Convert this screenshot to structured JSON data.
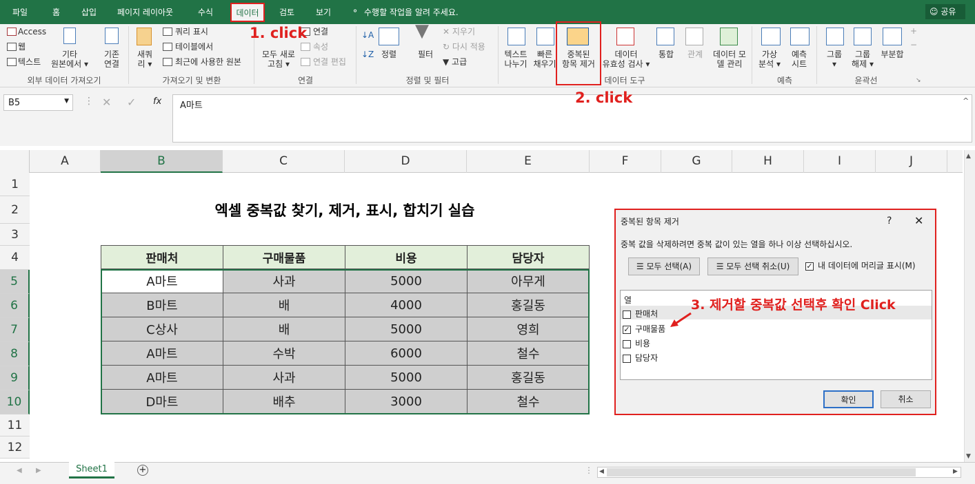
{
  "tabs": [
    "파일",
    "홈",
    "삽입",
    "페이지 레이아웃",
    "수식",
    "데이터",
    "검토",
    "보기"
  ],
  "tell_me": "수행할 작업을 알려 주세요.",
  "share": "공유",
  "ribbon": {
    "access": "Access",
    "web": "웹",
    "text": "텍스트",
    "other_sources": [
      "기타",
      "원본에서"
    ],
    "existing_conn": [
      "기존",
      "연결"
    ],
    "new_query": [
      "새쿼",
      "리"
    ],
    "show_query": "쿼리 표시",
    "from_table": "테이블에서",
    "recent_sources": "최근에 사용한 원본",
    "refresh_all": [
      "모두 새로",
      "고침"
    ],
    "connections": "연결",
    "properties": "속성",
    "edit_links": "연결 편집",
    "sort": "정렬",
    "filter": "필터",
    "clear": "지우기",
    "reapply": "다시 적용",
    "advanced": "고급",
    "text_to_columns": [
      "텍스트",
      "나누기"
    ],
    "flash_fill": [
      "빠른",
      "채우기"
    ],
    "remove_duplicates": [
      "중복된",
      "항목 제거"
    ],
    "data_validation": [
      "데이터",
      "유효성 검사"
    ],
    "consolidate": "통합",
    "relationships": "관계",
    "data_model": [
      "데이터 모",
      "델 관리"
    ],
    "what_if": [
      "가상",
      "분석"
    ],
    "forecast_sheet": [
      "예측",
      "시트"
    ],
    "group": "그룹",
    "ungroup": [
      "그룹",
      "해제"
    ],
    "subtotal": "부분합",
    "groups": [
      "외부 데이터 가져오기",
      "가져오기 및 변환",
      "연결",
      "정렬 및 필터",
      "데이터 도구",
      "예측",
      "윤곽선"
    ]
  },
  "name_box": "B5",
  "formula": "A마트",
  "columns": [
    "A",
    "B",
    "C",
    "D",
    "E",
    "F",
    "G",
    "H",
    "I",
    "J"
  ],
  "rows": [
    "1",
    "2",
    "3",
    "4",
    "5",
    "6",
    "7",
    "8",
    "9",
    "10",
    "11",
    "12"
  ],
  "sheet_title": "엑셀 중복값 찾기, 제거, 표시, 합치기 실습",
  "table": {
    "headers": [
      "판매처",
      "구매물품",
      "비용",
      "담당자"
    ],
    "rows": [
      [
        "A마트",
        "사과",
        "5000",
        "아무게"
      ],
      [
        "B마트",
        "배",
        "4000",
        "홍길동"
      ],
      [
        "C상사",
        "배",
        "5000",
        "영희"
      ],
      [
        "A마트",
        "수박",
        "6000",
        "철수"
      ],
      [
        "A마트",
        "사과",
        "5000",
        "홍길동"
      ],
      [
        "D마트",
        "배추",
        "3000",
        "철수"
      ]
    ]
  },
  "dialog": {
    "title": "중복된 항목 제거",
    "help": "?",
    "description": "중복 값을 삭제하려면 중복 값이 있는 열을 하나 이상 선택하십시오.",
    "select_all": "모두 선택(A)",
    "unselect_all": "모두 선택 취소(U)",
    "has_headers": "내 데이터에 머리글 표시(M)",
    "list_header": "열",
    "items": [
      {
        "label": "판매처",
        "checked": false
      },
      {
        "label": "구매물품",
        "checked": true
      },
      {
        "label": "비용",
        "checked": false
      },
      {
        "label": "담당자",
        "checked": false
      }
    ],
    "ok": "확인",
    "cancel": "취소"
  },
  "annotations": {
    "step1": "1. click",
    "step2": "2. click",
    "step3": "3. 제거할 중복값 선택후 확인 Click"
  },
  "sheet_tab": "Sheet1"
}
